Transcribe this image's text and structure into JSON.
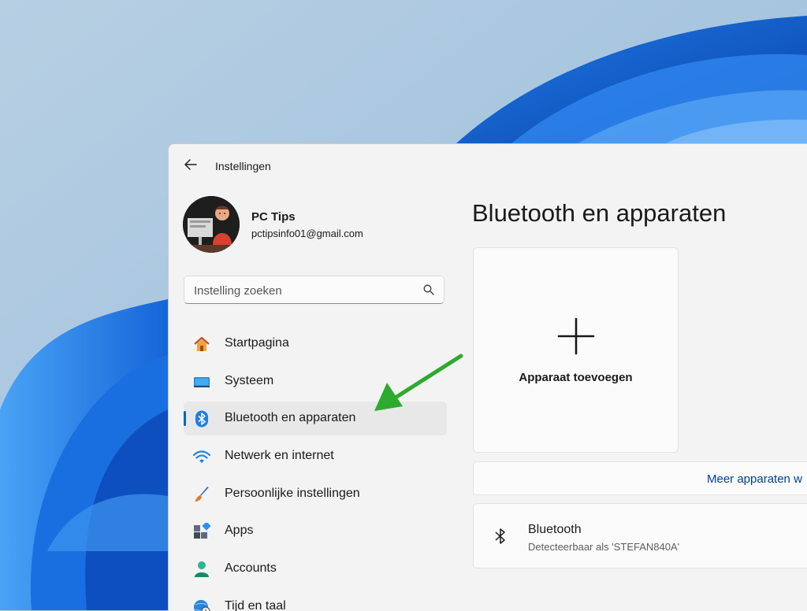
{
  "window": {
    "title": "Instellingen"
  },
  "profile": {
    "name": "PC Tips",
    "email": "pctipsinfo01@gmail.com"
  },
  "search": {
    "placeholder": "Instelling zoeken"
  },
  "nav": {
    "selected": "Bluetooth en apparaten",
    "items": [
      {
        "label": "Startpagina",
        "icon": "home-icon"
      },
      {
        "label": "Systeem",
        "icon": "monitor-icon"
      },
      {
        "label": "Bluetooth en apparaten",
        "icon": "bluetooth-icon"
      },
      {
        "label": "Netwerk en internet",
        "icon": "wifi-icon"
      },
      {
        "label": "Persoonlijke instellingen",
        "icon": "paintbrush-icon"
      },
      {
        "label": "Apps",
        "icon": "apps-icon"
      },
      {
        "label": "Accounts",
        "icon": "person-icon"
      },
      {
        "label": "Tijd en taal",
        "icon": "globe-clock-icon"
      }
    ]
  },
  "main": {
    "title": "Bluetooth en apparaten",
    "add_device": {
      "label": "Apparaat toevoegen",
      "icon": "plus-icon"
    },
    "more_devices": {
      "label": "Meer apparaten w"
    },
    "bluetooth": {
      "title": "Bluetooth",
      "subtitle": "Detecteerbaar als 'STEFAN840A'",
      "icon": "bluetooth-icon"
    }
  },
  "annotation": {
    "arrow_color": "#2eaa2e"
  },
  "colors": {
    "accent": "#0067c0",
    "window_bg": "#f3f3f3"
  }
}
